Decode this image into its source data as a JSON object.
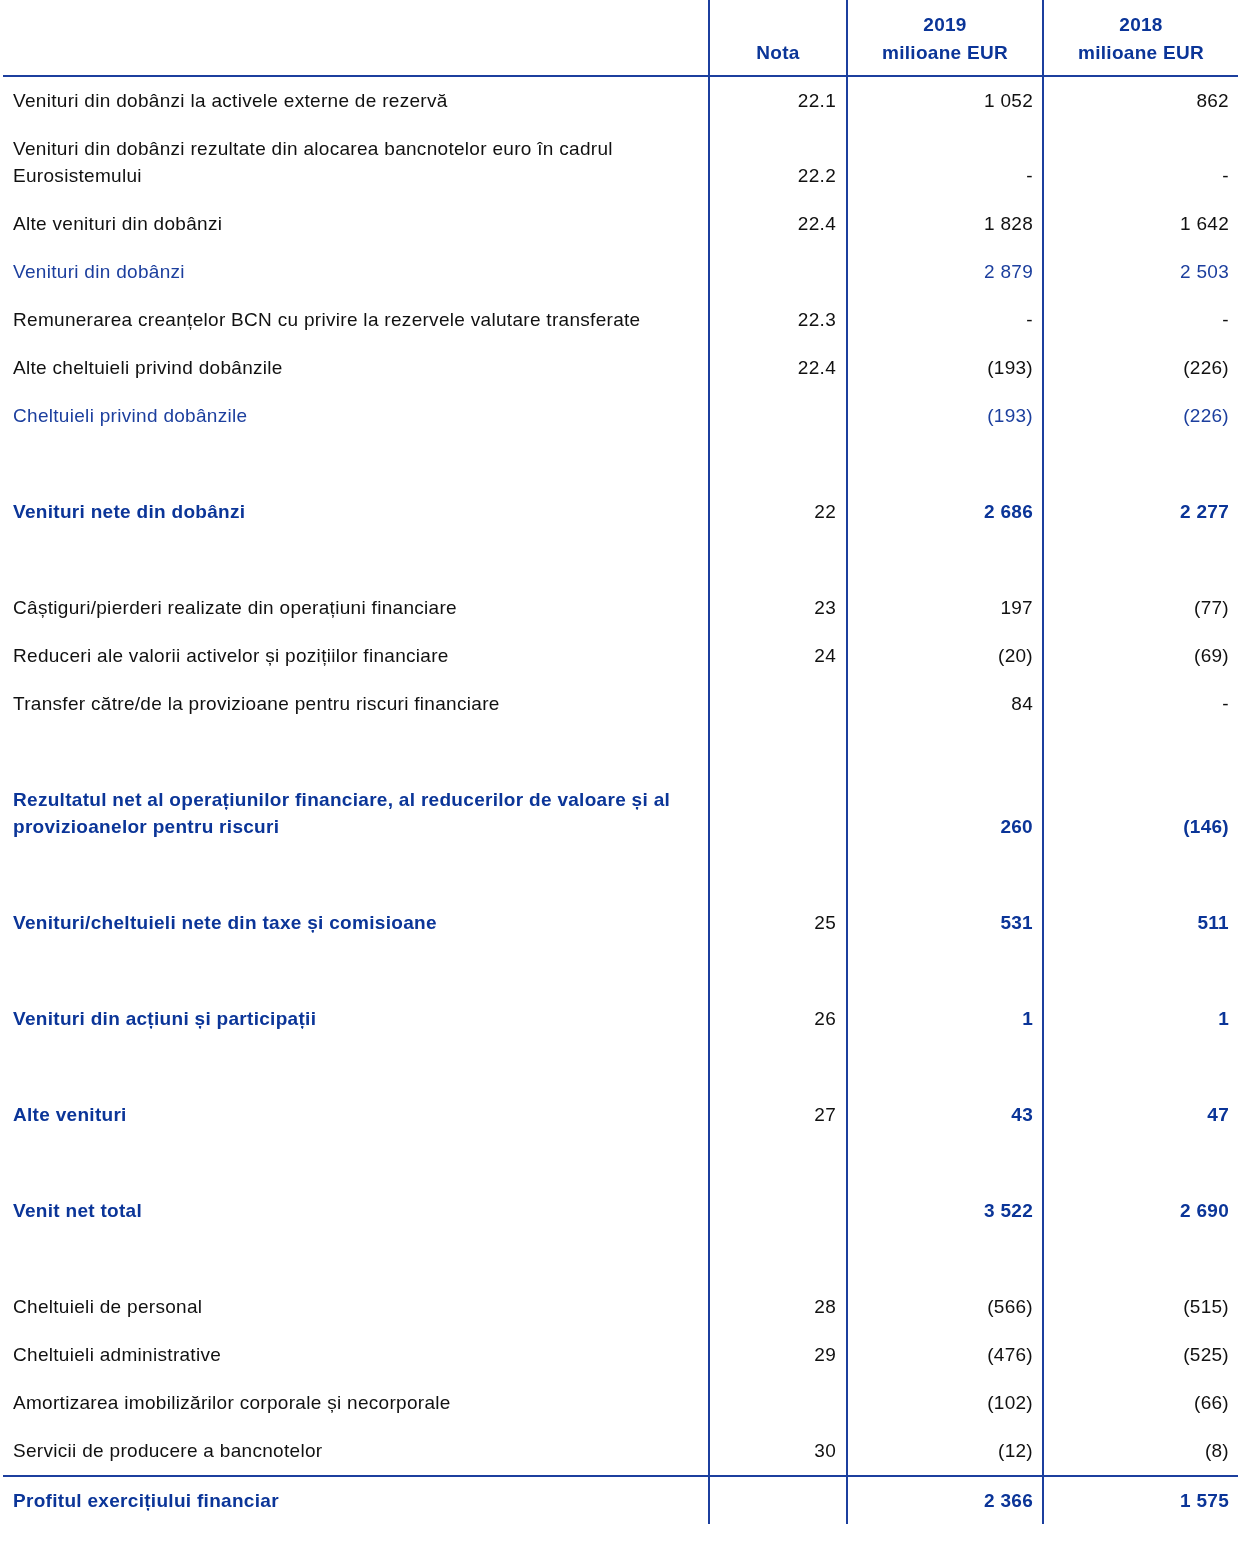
{
  "table": {
    "columns": [
      {},
      {
        "lines": [
          "Nota"
        ]
      },
      {
        "lines": [
          "2019",
          "milioane EUR"
        ]
      },
      {
        "lines": [
          "2018",
          "milioane EUR"
        ]
      }
    ],
    "rows": [
      {
        "kind": "item",
        "label": "Venituri din dobânzi la activele externe de rezervă",
        "note": "22.1",
        "values": [
          "1 052",
          "862"
        ]
      },
      {
        "kind": "item",
        "label": "Venituri din dobânzi rezultate din alocarea bancnotelor euro în cadrul Eurosistemului",
        "note": "22.2",
        "values": [
          "-",
          "-"
        ]
      },
      {
        "kind": "item",
        "label": "Alte venituri din dobânzi",
        "note": "22.4",
        "values": [
          "1 828",
          "1 642"
        ]
      },
      {
        "kind": "subtotal",
        "label": "Venituri din dobânzi",
        "note": "",
        "values": [
          "2 879",
          "2 503"
        ]
      },
      {
        "kind": "item",
        "label": "Remunerarea creanțelor BCN cu privire la rezervele valutare transferate",
        "note": "22.3",
        "values": [
          "-",
          "-"
        ]
      },
      {
        "kind": "item",
        "label": "Alte cheltuieli privind dobânzile",
        "note": "22.4",
        "values": [
          "(193)",
          "(226)"
        ]
      },
      {
        "kind": "subtotal",
        "label": "Cheltuieli privind dobânzile",
        "note": "",
        "values": [
          "(193)",
          "(226)"
        ]
      },
      {
        "kind": "total",
        "label": "Venituri nete din dobânzi",
        "note": "22",
        "values": [
          "2 686",
          "2 277"
        ]
      },
      {
        "kind": "item",
        "label": "Câștiguri/pierderi realizate din operațiuni financiare",
        "note": "23",
        "values": [
          "197",
          "(77)"
        ]
      },
      {
        "kind": "item",
        "label": "Reduceri ale valorii activelor și pozițiilor financiare",
        "note": "24",
        "values": [
          "(20)",
          "(69)"
        ]
      },
      {
        "kind": "item",
        "label": "Transfer către/de la provizioane pentru riscuri financiare",
        "note": "",
        "values": [
          "84",
          "-"
        ]
      },
      {
        "kind": "total",
        "label": "Rezultatul net al operațiunilor financiare, al reducerilor de valoare și al provizioanelor pentru riscuri",
        "note": "",
        "values": [
          "260",
          "(146)"
        ]
      },
      {
        "kind": "total",
        "label": "Venituri/cheltuieli nete din taxe și comisioane",
        "note": "25",
        "values": [
          "531",
          "511"
        ]
      },
      {
        "kind": "total",
        "label": "Venituri din acțiuni și participații",
        "note": "26",
        "values": [
          "1",
          "1"
        ]
      },
      {
        "kind": "total",
        "label": "Alte venituri",
        "note": "27",
        "values": [
          "43",
          "47"
        ]
      },
      {
        "kind": "total",
        "label": "Venit net total",
        "note": "",
        "values": [
          "3 522",
          "2 690"
        ]
      },
      {
        "kind": "item",
        "label": "Cheltuieli de personal",
        "note": "28",
        "values": [
          "(566)",
          "(515)"
        ]
      },
      {
        "kind": "item",
        "label": "Cheltuieli administrative",
        "note": "29",
        "values": [
          "(476)",
          "(525)"
        ]
      },
      {
        "kind": "item",
        "label": "Amortizarea imobilizărilor corporale și necorporale",
        "note": "",
        "values": [
          "(102)",
          "(66)"
        ]
      },
      {
        "kind": "item",
        "label": "Servicii de producere a bancnotelor",
        "note": "30",
        "values": [
          "(12)",
          "(8)"
        ]
      },
      {
        "kind": "final",
        "label": "Profitul exercițiului financiar",
        "note": "",
        "values": [
          "2 366",
          "1 575"
        ]
      }
    ]
  }
}
